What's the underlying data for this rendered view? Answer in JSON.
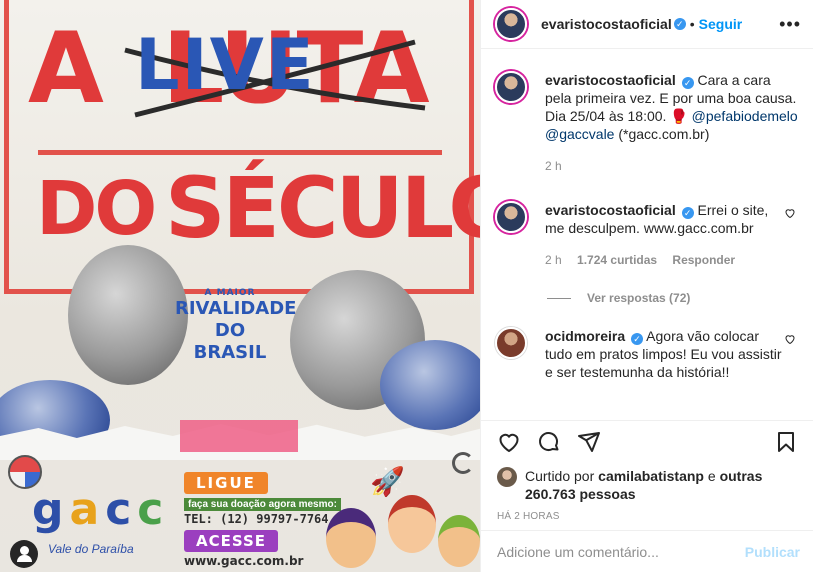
{
  "poster": {
    "title_a": "A",
    "title_luta": "LUTA",
    "title_live": "LIVE",
    "title_do": "DO",
    "title_seculo": "SÉCULO",
    "band_l1": "A MAIOR",
    "band_l2": "RIVALIDADE",
    "band_l3": "DO",
    "band_l4": "BRASIL",
    "logo_g": "g",
    "logo_a": "a",
    "logo_c1": "c",
    "logo_c2": "c",
    "logo_sub": "Vale do Paraíba",
    "ligue": "LIGUE",
    "donate": "faça sua doação agora mesmo:",
    "tel": "TEL: (12) 99797-7764",
    "acesse": "ACESSE",
    "site": "www.gacc.com.br"
  },
  "header": {
    "username": "evaristocostaoficial",
    "follow_label": "Seguir",
    "dot": "•",
    "more": "•••"
  },
  "caption": {
    "username": "evaristocostaoficial",
    "text": "Cara a cara pela primeira vez. E por uma boa causa. Dia 25/04 às 18:00. 🥊",
    "mention1": "@pefabiodemelo",
    "mention2": "@gaccvale",
    "text2": "(*gacc.com.br)",
    "time": "2 h"
  },
  "comment1": {
    "username": "evaristocostaoficial",
    "text": "Errei o site, me desculpem. www.gacc.com.br",
    "time": "2 h",
    "likes": "1.724 curtidas",
    "reply_label": "Responder",
    "view_replies": "Ver respostas (72)"
  },
  "comment2": {
    "username": "ocidmoreira",
    "text": "Agora vão colocar tudo em pratos limpos! Eu vou assistir e ser testemunha da história!!"
  },
  "likes": {
    "prefix": "Curtido por",
    "user": "camilabatistanp",
    "and": "e",
    "others": "outras 260.763 pessoas"
  },
  "time_ago": "HÁ 2 HORAS",
  "add_comment": {
    "placeholder": "Adicione um comentário...",
    "publish_label": "Publicar"
  },
  "colors": {
    "accent_blue": "#0095f6",
    "poster_red": "#e03a3a",
    "poster_blue": "#2a57b5"
  }
}
